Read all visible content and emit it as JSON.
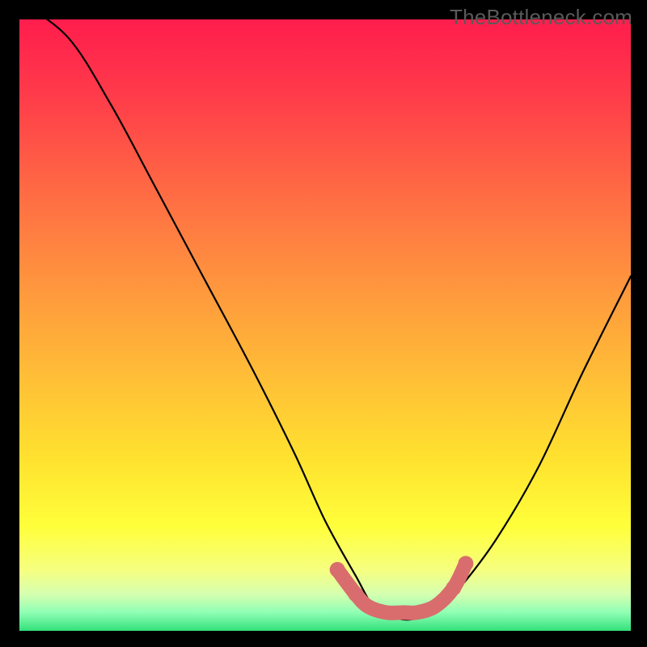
{
  "watermark": "TheBottleneck.com",
  "chart_data": {
    "type": "line",
    "title": "",
    "xlabel": "",
    "ylabel": "",
    "xlim": [
      0,
      100
    ],
    "ylim": [
      0,
      100
    ],
    "grid": false,
    "series": [
      {
        "name": "bottleneck-curve",
        "x": [
          0,
          8,
          15,
          22,
          30,
          38,
          45,
          50,
          55,
          58,
          62,
          65,
          68,
          72,
          78,
          85,
          92,
          100
        ],
        "y": [
          103,
          97,
          86,
          73,
          58,
          43,
          29,
          18,
          9,
          4,
          2,
          2,
          3,
          7,
          15,
          27,
          42,
          58
        ]
      }
    ],
    "highlight_segment": {
      "name": "valley-marker",
      "color": "#d96d6d",
      "x": [
        52,
        55,
        57,
        60,
        63,
        65,
        68,
        71,
        73
      ],
      "y": [
        10,
        6,
        4,
        3,
        3,
        3,
        4,
        7,
        11
      ]
    },
    "background_gradient": {
      "stops": [
        {
          "offset": 0.0,
          "color": "#ff1d4d"
        },
        {
          "offset": 0.12,
          "color": "#ff3a4a"
        },
        {
          "offset": 0.28,
          "color": "#ff6a44"
        },
        {
          "offset": 0.45,
          "color": "#ff9a3d"
        },
        {
          "offset": 0.6,
          "color": "#ffc236"
        },
        {
          "offset": 0.72,
          "color": "#ffe22f"
        },
        {
          "offset": 0.83,
          "color": "#ffff3a"
        },
        {
          "offset": 0.9,
          "color": "#f6ff80"
        },
        {
          "offset": 0.94,
          "color": "#d6ffb0"
        },
        {
          "offset": 0.97,
          "color": "#8fffb5"
        },
        {
          "offset": 1.0,
          "color": "#33e07a"
        }
      ]
    }
  }
}
